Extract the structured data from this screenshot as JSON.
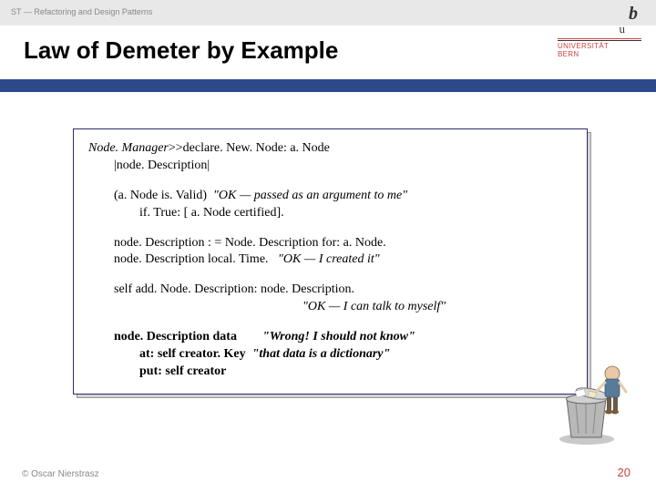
{
  "header": {
    "breadcrumb": "ST — Refactoring and Design Patterns"
  },
  "logo": {
    "b": "b",
    "u": "u",
    "uni_line1": "UNIVERSITÄT",
    "uni_line2": "BERN"
  },
  "title": "Law of Demeter by Example",
  "code": {
    "l1a": "Node. Manager",
    "l1b": ">>declare. New. Node: a. Node",
    "l2": "|node. Description|",
    "l3a": "(a. Node is. Valid)",
    "l3b": "\"OK — passed as an argument to me\"",
    "l4": "if. True: [ a. Node certified].",
    "l5": "node. Description : = Node. Description for: a. Node.",
    "l6a": "node. Description local. Time.",
    "l6b": "\"OK — I created it\"",
    "l7": "self add. Node. Description: node. Description.",
    "l8": "\"OK — I can talk to myself\"",
    "l9a": "node. Description data",
    "l9b": "\"Wrong! I should not know\"",
    "l10a": "at: self creator. Key",
    "l10b": "\"that data is a dictionary\"",
    "l11": "put: self creator"
  },
  "footer": {
    "copyright": "© Oscar Nierstrasz",
    "page": "20"
  }
}
